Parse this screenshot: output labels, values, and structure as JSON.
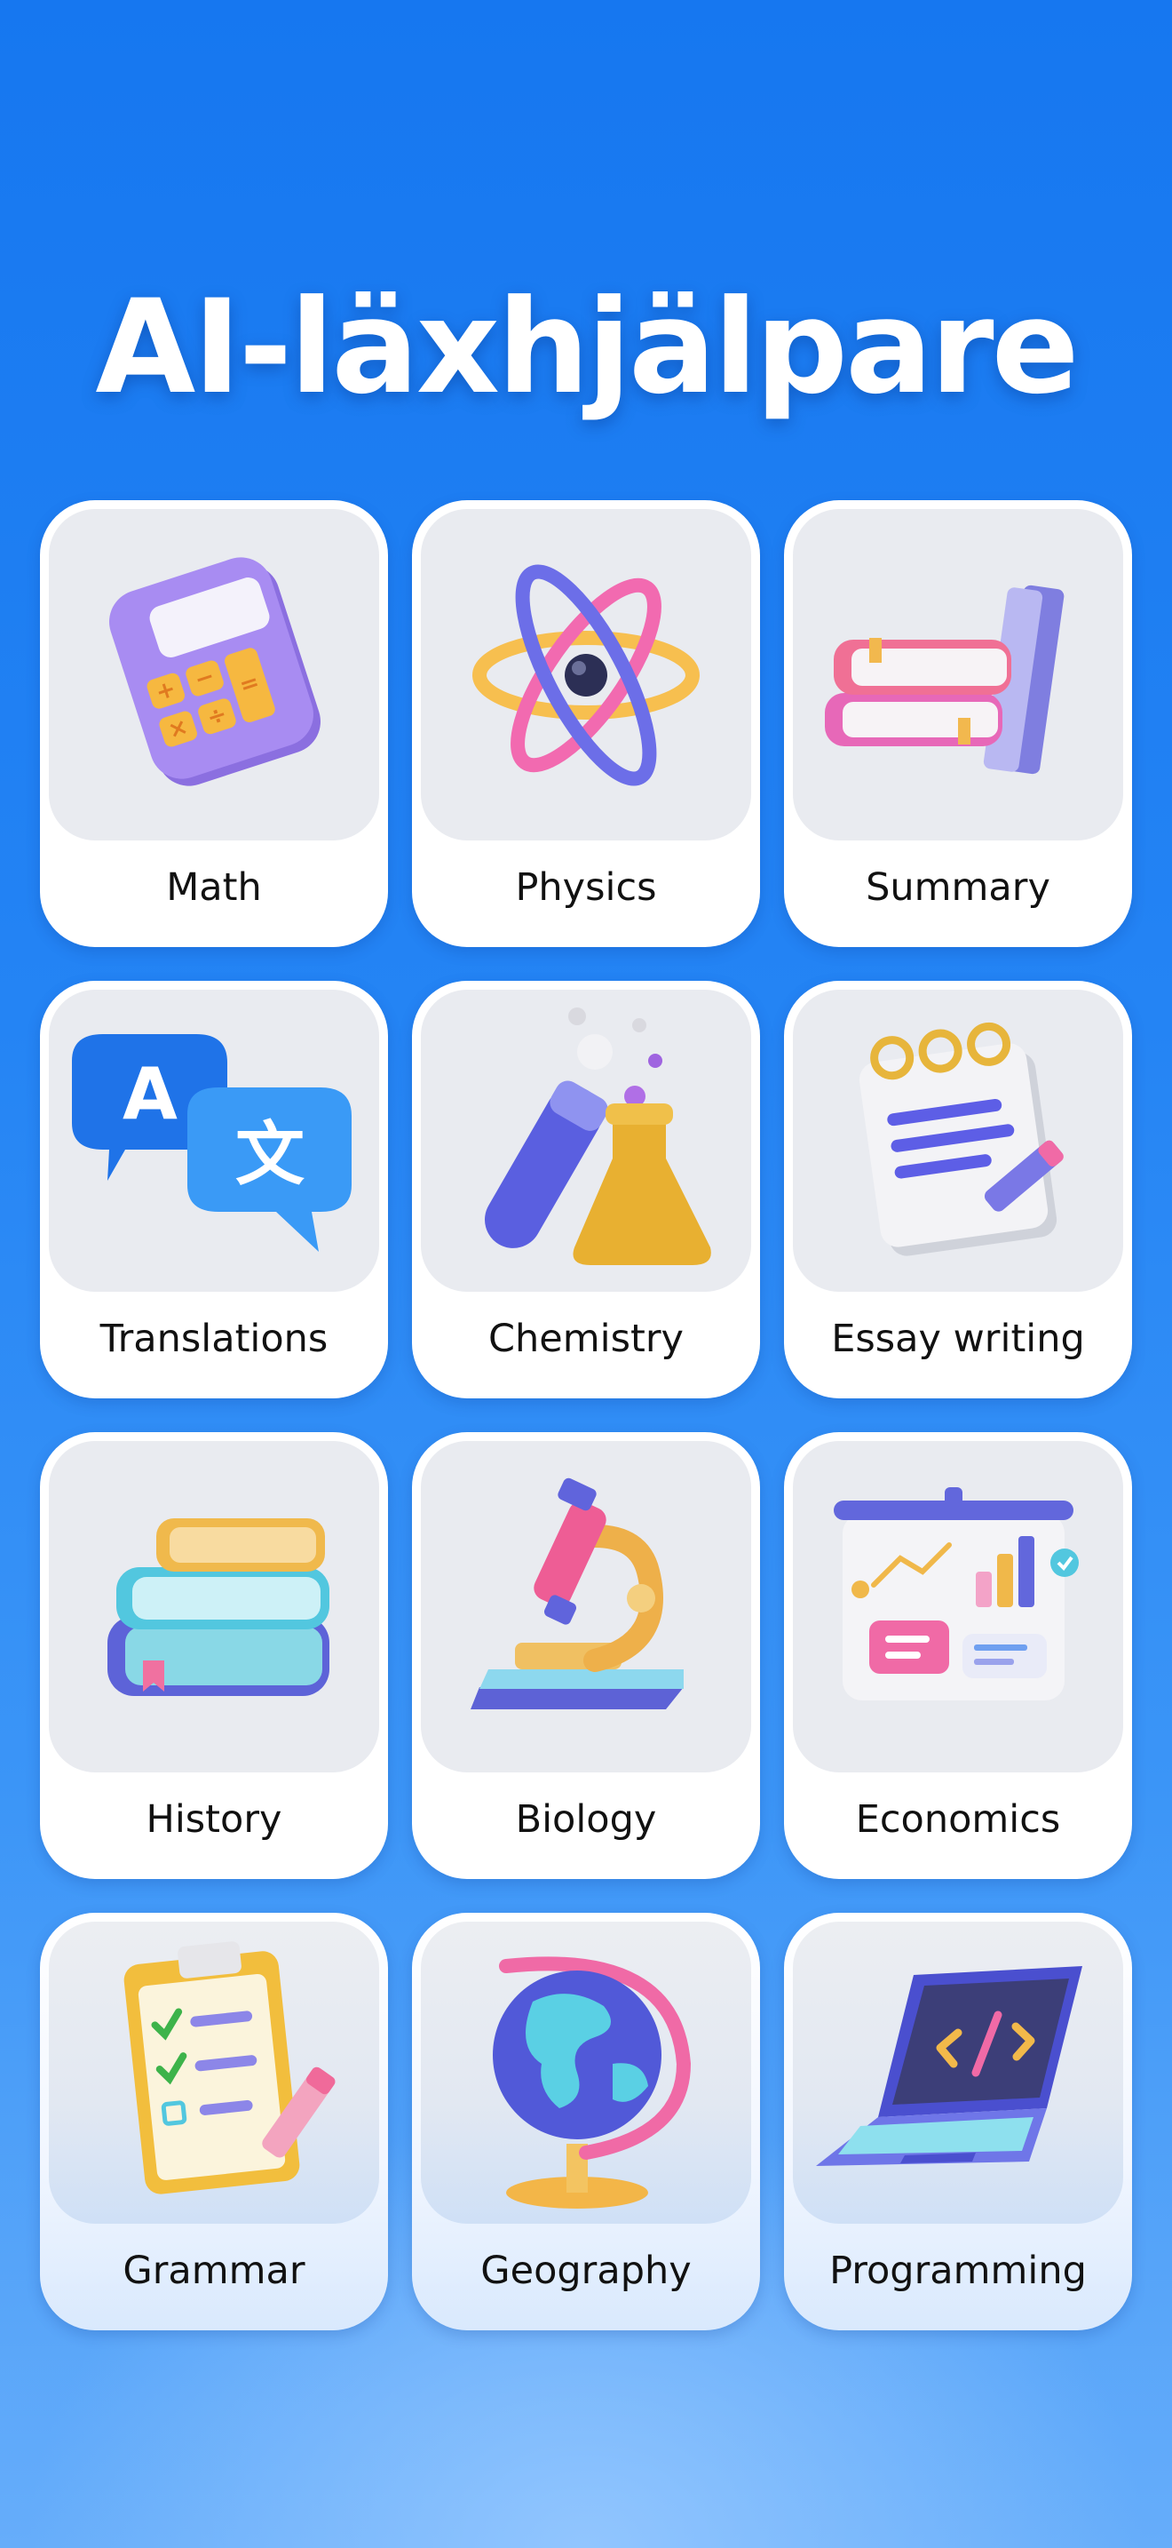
{
  "title": "AI-läxhjälpare",
  "subjects": [
    {
      "label": "Math",
      "icon": "calculator-icon"
    },
    {
      "label": "Physics",
      "icon": "atom-icon"
    },
    {
      "label": "Summary",
      "icon": "books-icon"
    },
    {
      "label": "Translations",
      "icon": "translate-bubbles-icon"
    },
    {
      "label": "Chemistry",
      "icon": "test-tube-flask-icon"
    },
    {
      "label": "Essay writing",
      "icon": "notepad-pencil-icon"
    },
    {
      "label": "History",
      "icon": "book-stack-icon"
    },
    {
      "label": "Biology",
      "icon": "microscope-icon"
    },
    {
      "label": "Economics",
      "icon": "presentation-board-icon"
    },
    {
      "label": "Grammar",
      "icon": "checklist-clipboard-icon"
    },
    {
      "label": "Geography",
      "icon": "globe-icon"
    },
    {
      "label": "Programming",
      "icon": "laptop-code-icon"
    }
  ],
  "colors": {
    "background_top": "#1677f0",
    "background_bottom": "#66adfa",
    "card": "#ffffff",
    "tile": "#e9ebf0"
  }
}
